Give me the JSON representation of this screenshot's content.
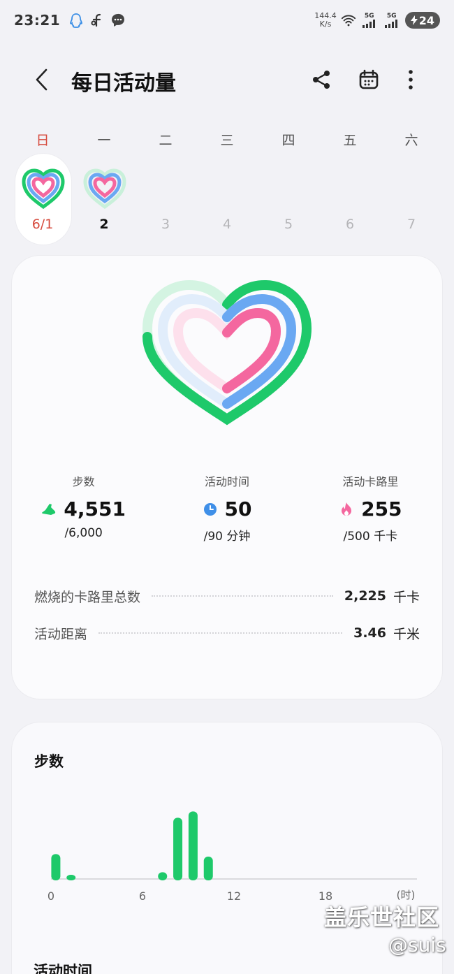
{
  "status_bar": {
    "time": "23:21",
    "net_speed_value": "144.4",
    "net_speed_unit": "K/s",
    "signal1": "5G",
    "signal2": "5G",
    "battery": "24"
  },
  "header": {
    "title": "每日活动量",
    "icons": [
      "back-icon",
      "share-icon",
      "calendar-icon",
      "more-icon"
    ]
  },
  "week": {
    "days": [
      {
        "letter": "日",
        "num": "6/1"
      },
      {
        "letter": "一",
        "num": "2"
      },
      {
        "letter": "二",
        "num": "3"
      },
      {
        "letter": "三",
        "num": "4"
      },
      {
        "letter": "四",
        "num": "5"
      },
      {
        "letter": "五",
        "num": "6"
      },
      {
        "letter": "六",
        "num": "7"
      }
    ]
  },
  "summary": {
    "steps": {
      "label": "步数",
      "value": "4,551",
      "goal": "/6,000",
      "progress": 0.7585
    },
    "active_time": {
      "label": "活动时间",
      "value": "50",
      "goal": "/90 分钟",
      "progress": 0.556
    },
    "active_cal": {
      "label": "活动卡路里",
      "value": "255",
      "goal": "/500 千卡",
      "progress": 0.51
    },
    "total_burned": {
      "label": "燃烧的卡路里总数",
      "value": "2,225",
      "unit": "千卡"
    },
    "distance": {
      "label": "活动距离",
      "value": "3.46",
      "unit": "千米"
    }
  },
  "colors": {
    "steps": "#1ec96a",
    "active_time": "#6aa8f2",
    "active_cal": "#f4679f",
    "sunday": "#d64a3c"
  },
  "steps_card": {
    "title": "步数"
  },
  "chart_data": {
    "type": "bar",
    "title": "步数",
    "x_ticks": [
      "0",
      "6",
      "12",
      "18"
    ],
    "x_unit": "(时)",
    "hours": [
      0,
      1,
      2,
      3,
      4,
      5,
      6,
      7,
      8,
      9,
      10,
      11,
      12,
      13,
      14,
      15,
      16,
      17,
      18,
      19,
      20,
      21,
      22,
      23
    ],
    "values": [
      480,
      80,
      0,
      0,
      0,
      0,
      0,
      130,
      1180,
      1300,
      430,
      0,
      0,
      0,
      0,
      0,
      0,
      0,
      0,
      0,
      0,
      0,
      0,
      0
    ],
    "ylim": [
      0,
      1400
    ]
  },
  "next_section": {
    "title": "活动时间"
  },
  "watermark": {
    "line1": "盖乐世社区",
    "line2": "@suis"
  }
}
